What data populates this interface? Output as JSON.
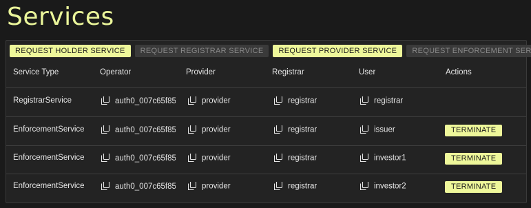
{
  "page": {
    "title": "Services"
  },
  "toolbar": {
    "buttons": [
      {
        "label": "REQUEST HOLDER SERVICE",
        "enabled": true
      },
      {
        "label": "REQUEST REGISTRAR SERVICE",
        "enabled": false
      },
      {
        "label": "REQUEST PROVIDER SERVICE",
        "enabled": true
      },
      {
        "label": "REQUEST ENFORCEMENT SERVICE",
        "enabled": false
      }
    ]
  },
  "table": {
    "columns": [
      "Service Type",
      "Operator",
      "Provider",
      "Registrar",
      "User",
      "Actions"
    ],
    "rows": [
      {
        "service_type": "RegistrarService",
        "operator": "auth0_007c65f85",
        "provider": "provider",
        "registrar": "registrar",
        "user": "registrar",
        "action": ""
      },
      {
        "service_type": "EnforcementService",
        "operator": "auth0_007c65f85",
        "provider": "provider",
        "registrar": "registrar",
        "user": "issuer",
        "action": "TERMINATE"
      },
      {
        "service_type": "EnforcementService",
        "operator": "auth0_007c65f85",
        "provider": "provider",
        "registrar": "registrar",
        "user": "investor1",
        "action": "TERMINATE"
      },
      {
        "service_type": "EnforcementService",
        "operator": "auth0_007c65f85",
        "provider": "provider",
        "registrar": "registrar",
        "user": "investor2",
        "action": "TERMINATE"
      }
    ]
  },
  "colors": {
    "accent": "#eef79a",
    "background": "#1a1a1a",
    "panel": "#232323",
    "disabled": "#3a3a3a"
  },
  "icons": {
    "copy": "copy-icon"
  }
}
